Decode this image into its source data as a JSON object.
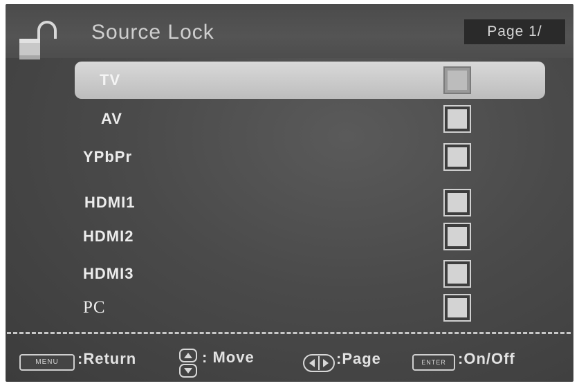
{
  "header": {
    "title": "Source Lock",
    "page_indicator": "Page 1/"
  },
  "sources": [
    {
      "label": "TV",
      "selected": true
    },
    {
      "label": "AV",
      "selected": false
    },
    {
      "label": "YPbPr",
      "selected": false
    },
    {
      "label": "HDMI1",
      "selected": false
    },
    {
      "label": "HDMI2",
      "selected": false
    },
    {
      "label": "HDMI3",
      "selected": false
    },
    {
      "label": "PC",
      "selected": false
    }
  ],
  "footer": {
    "menu_key": "MENU",
    "menu_hint": ":Return",
    "move_hint": ": Move",
    "page_hint": ":Page",
    "enter_key": "ENTER",
    "enter_hint": ":On/Off"
  },
  "icons": {
    "header": "padlock-icon",
    "move": "up-down-arrows-icon",
    "page": "left-right-arrows-icon"
  }
}
